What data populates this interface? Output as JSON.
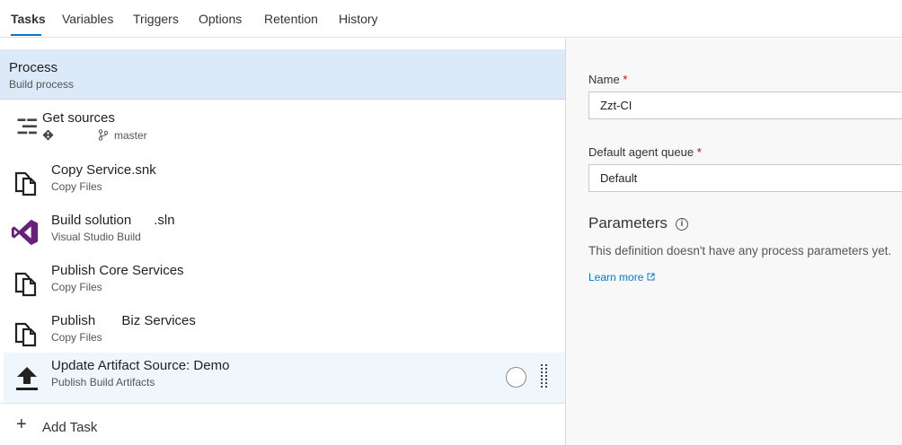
{
  "tabs": [
    {
      "label": "Tasks"
    },
    {
      "label": "Variables"
    },
    {
      "label": "Triggers"
    },
    {
      "label": "Options"
    },
    {
      "label": "Retention"
    },
    {
      "label": "History"
    }
  ],
  "process": {
    "title": "Process",
    "subtitle": "Build process"
  },
  "get_sources": {
    "title": "Get sources",
    "branch": "master"
  },
  "tasks": [
    {
      "title": "Copy Service.snk",
      "subtitle": "Copy Files",
      "icon": "copy-files-icon"
    },
    {
      "title": "Build solution      .sln",
      "subtitle": "Visual Studio Build",
      "icon": "visual-studio-icon"
    },
    {
      "title": "Publish Core Services",
      "subtitle": "Copy Files",
      "icon": "copy-files-icon"
    },
    {
      "title": "Publish       Biz Services",
      "subtitle": "Copy Files",
      "icon": "copy-files-icon"
    },
    {
      "title": "Update Artifact Source: Demo",
      "subtitle": "Publish Build Artifacts",
      "icon": "upload-icon"
    }
  ],
  "add_task": {
    "label": "Add Task"
  },
  "properties": {
    "name_label": "Name",
    "name_value": "Zzt-CI",
    "queue_label": "Default agent queue",
    "queue_value": "Default",
    "required_mark": "*",
    "parameters_title": "Parameters",
    "parameters_text": "This definition doesn't have any process parameters yet.",
    "learn_more": "Learn more"
  },
  "colors": {
    "accent": "#0078d7",
    "selected_bg": "#dbe9f8",
    "visual_studio": "#68217a"
  }
}
